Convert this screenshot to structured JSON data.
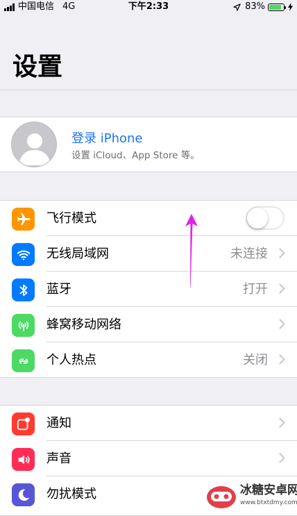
{
  "status_bar": {
    "carrier": "中国电信",
    "network": "4G",
    "time": "下午2:33",
    "battery_percent": "83%",
    "battery_level": 0.83,
    "battery_color": "#4cd964",
    "icons": [
      "signal-icon",
      "location-icon",
      "battery-icon",
      "charging-icon"
    ]
  },
  "page_title": "设置",
  "profile": {
    "name": "登录 iPhone",
    "subtitle": "设置 iCloud、App Store 等。",
    "link_color": "#1a74ff"
  },
  "group1": [
    {
      "label": "飞行模式",
      "icon": "airplane-icon",
      "color": "#ff9500",
      "control": "toggle",
      "toggle_on": false
    },
    {
      "label": "无线局域网",
      "icon": "wifi-icon",
      "color": "#007aff",
      "value": "未连接"
    },
    {
      "label": "蓝牙",
      "icon": "bluetooth-icon",
      "color": "#007aff",
      "value": "打开"
    },
    {
      "label": "蜂窝移动网络",
      "icon": "cellular-icon",
      "color": "#4cd964",
      "value": ""
    },
    {
      "label": "个人热点",
      "icon": "hotspot-icon",
      "color": "#4cd964",
      "value": "关闭"
    }
  ],
  "group2": [
    {
      "label": "通知",
      "icon": "notifications-icon",
      "color": "#ff3b30"
    },
    {
      "label": "声音",
      "icon": "sounds-icon",
      "color": "#ff2d55"
    },
    {
      "label": "勿扰模式",
      "icon": "moon-icon",
      "color": "#5856d6"
    }
  ],
  "watermark": {
    "title": "冰糖安卓网",
    "url": "www.btxtdmy.com"
  },
  "annotation_arrow_color": "#e020e8"
}
